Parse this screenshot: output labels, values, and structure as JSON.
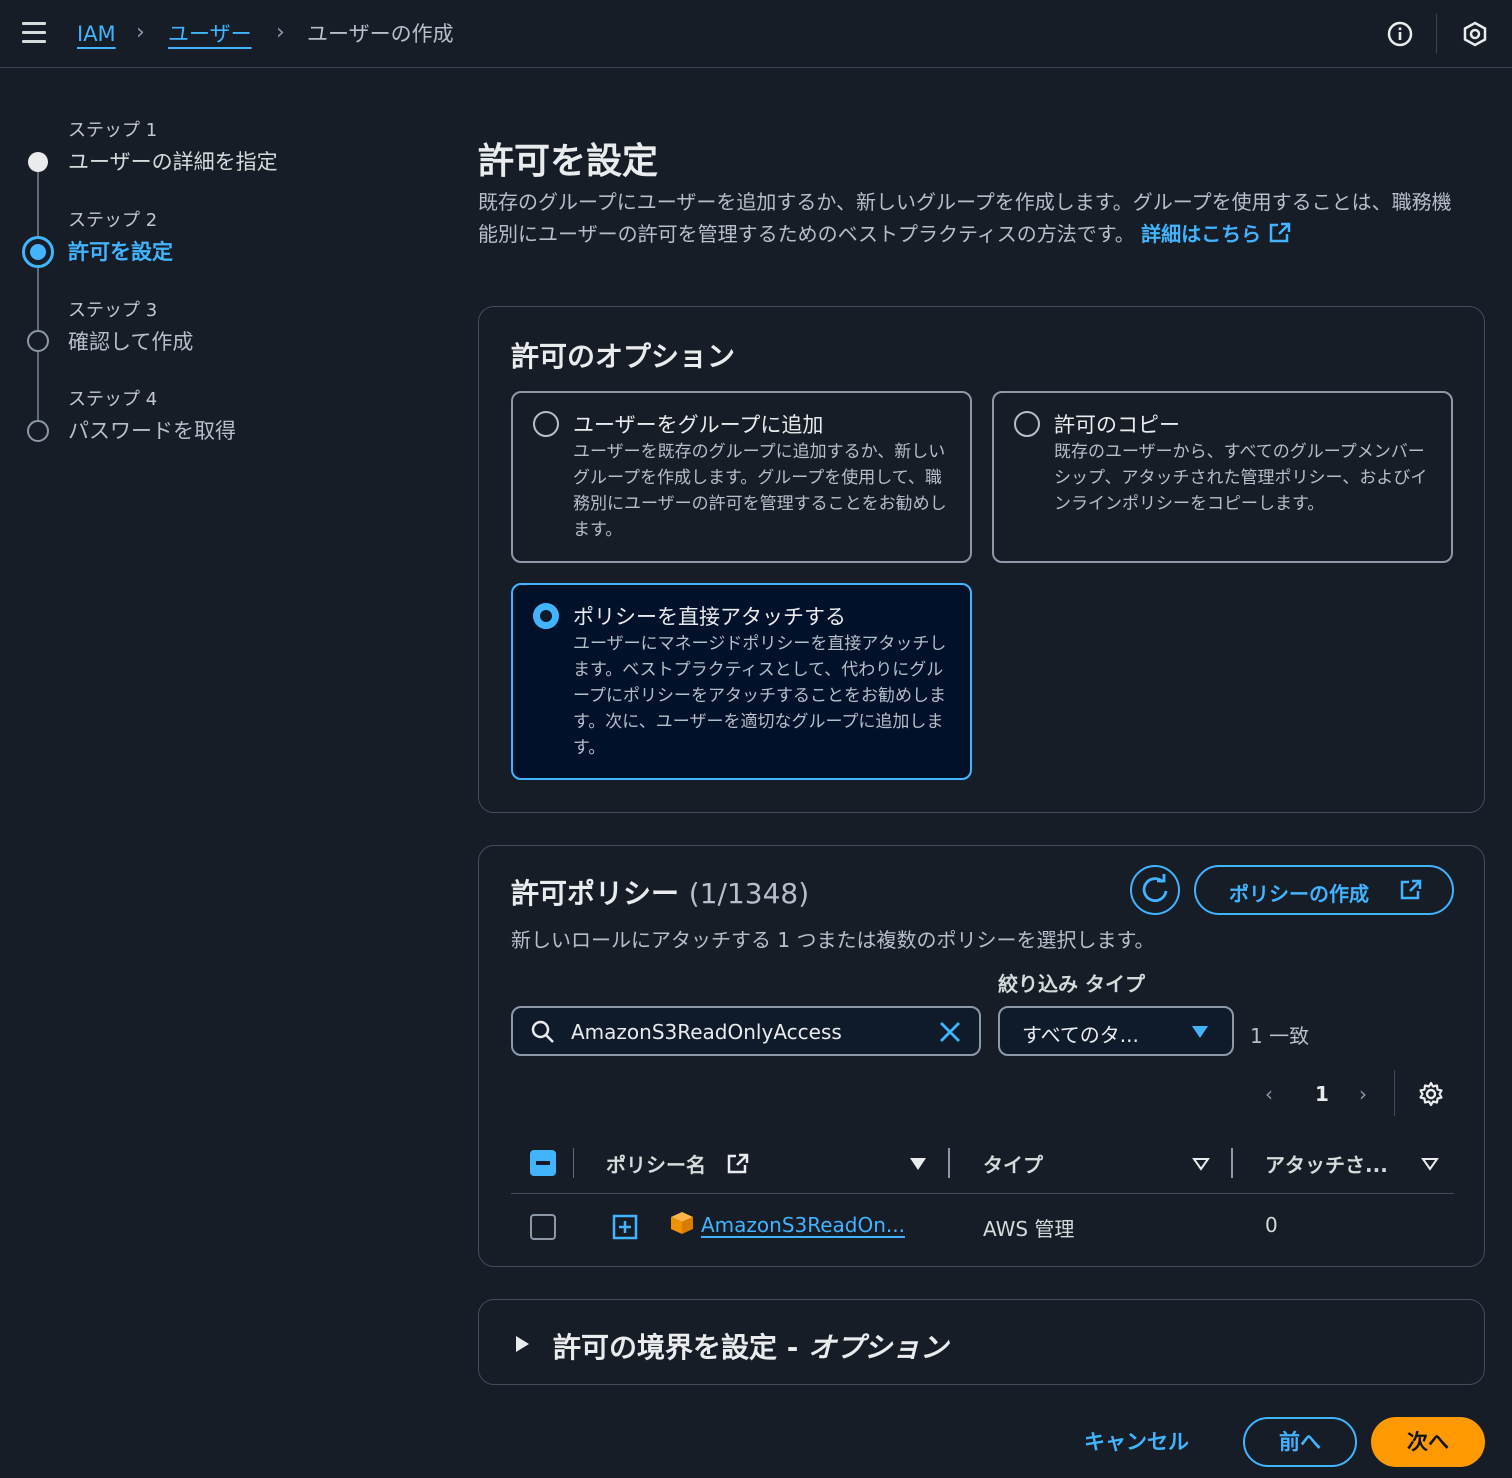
{
  "breadcrumb": {
    "items": [
      "IAM",
      "ユーザー"
    ],
    "current": "ユーザーの作成"
  },
  "steps": [
    {
      "label": "ステップ 1",
      "title": "ユーザーの詳細を指定",
      "state": "done"
    },
    {
      "label": "ステップ 2",
      "title": "許可を設定",
      "state": "active"
    },
    {
      "label": "ステップ 3",
      "title": "確認して作成",
      "state": "pending"
    },
    {
      "label": "ステップ 4",
      "title": "パスワードを取得",
      "state": "pending"
    }
  ],
  "main": {
    "title": "許可を設定",
    "description": "既存のグループにユーザーを追加するか、新しいグループを作成します。グループを使用することは、職務機能別にユーザーの許可を管理するためのベストプラクティスの方法です。",
    "learn_more": "詳細はこちら"
  },
  "options": {
    "title": "許可のオプション",
    "tiles": [
      {
        "title": "ユーザーをグループに追加",
        "desc": "ユーザーを既存のグループに追加するか、新しいグループを作成します。グループを使用して、職務別にユーザーの許可を管理することをお勧めします。",
        "selected": false
      },
      {
        "title": "許可のコピー",
        "desc": "既存のユーザーから、すべてのグループメンバーシップ、アタッチされた管理ポリシー、およびインラインポリシーをコピーします。",
        "selected": false
      },
      {
        "title": "ポリシーを直接アタッチする",
        "desc": "ユーザーにマネージドポリシーを直接アタッチします。ベストプラクティスとして、代わりにグループにポリシーをアタッチすることをお勧めします。次に、ユーザーを適切なグループに追加します。",
        "selected": true
      }
    ]
  },
  "policies": {
    "title": "許可ポリシー",
    "count": "(1/1348)",
    "create_button": "ポリシーの作成",
    "description": "新しいロールにアタッチする 1 つまたは複数のポリシーを選択します。",
    "filter_label": "絞り込み タイプ",
    "search_value": "AmazonS3ReadOnlyAccess",
    "type_select": "すべてのタ...",
    "match_count": "1 一致",
    "page": "1",
    "columns": [
      "ポリシー名",
      "タイプ",
      "アタッチさ..."
    ],
    "rows": [
      {
        "name": "AmazonS3ReadOn...",
        "type": "AWS 管理",
        "attached": "0"
      }
    ]
  },
  "boundary": {
    "title": "許可の境界を設定 - ",
    "title_italic": "オプション"
  },
  "footer": {
    "cancel": "キャンセル",
    "previous": "前へ",
    "next": "次へ"
  },
  "colors": {
    "accent": "#42b4ff",
    "primary_button": "#ff9900",
    "background": "#161d26"
  }
}
